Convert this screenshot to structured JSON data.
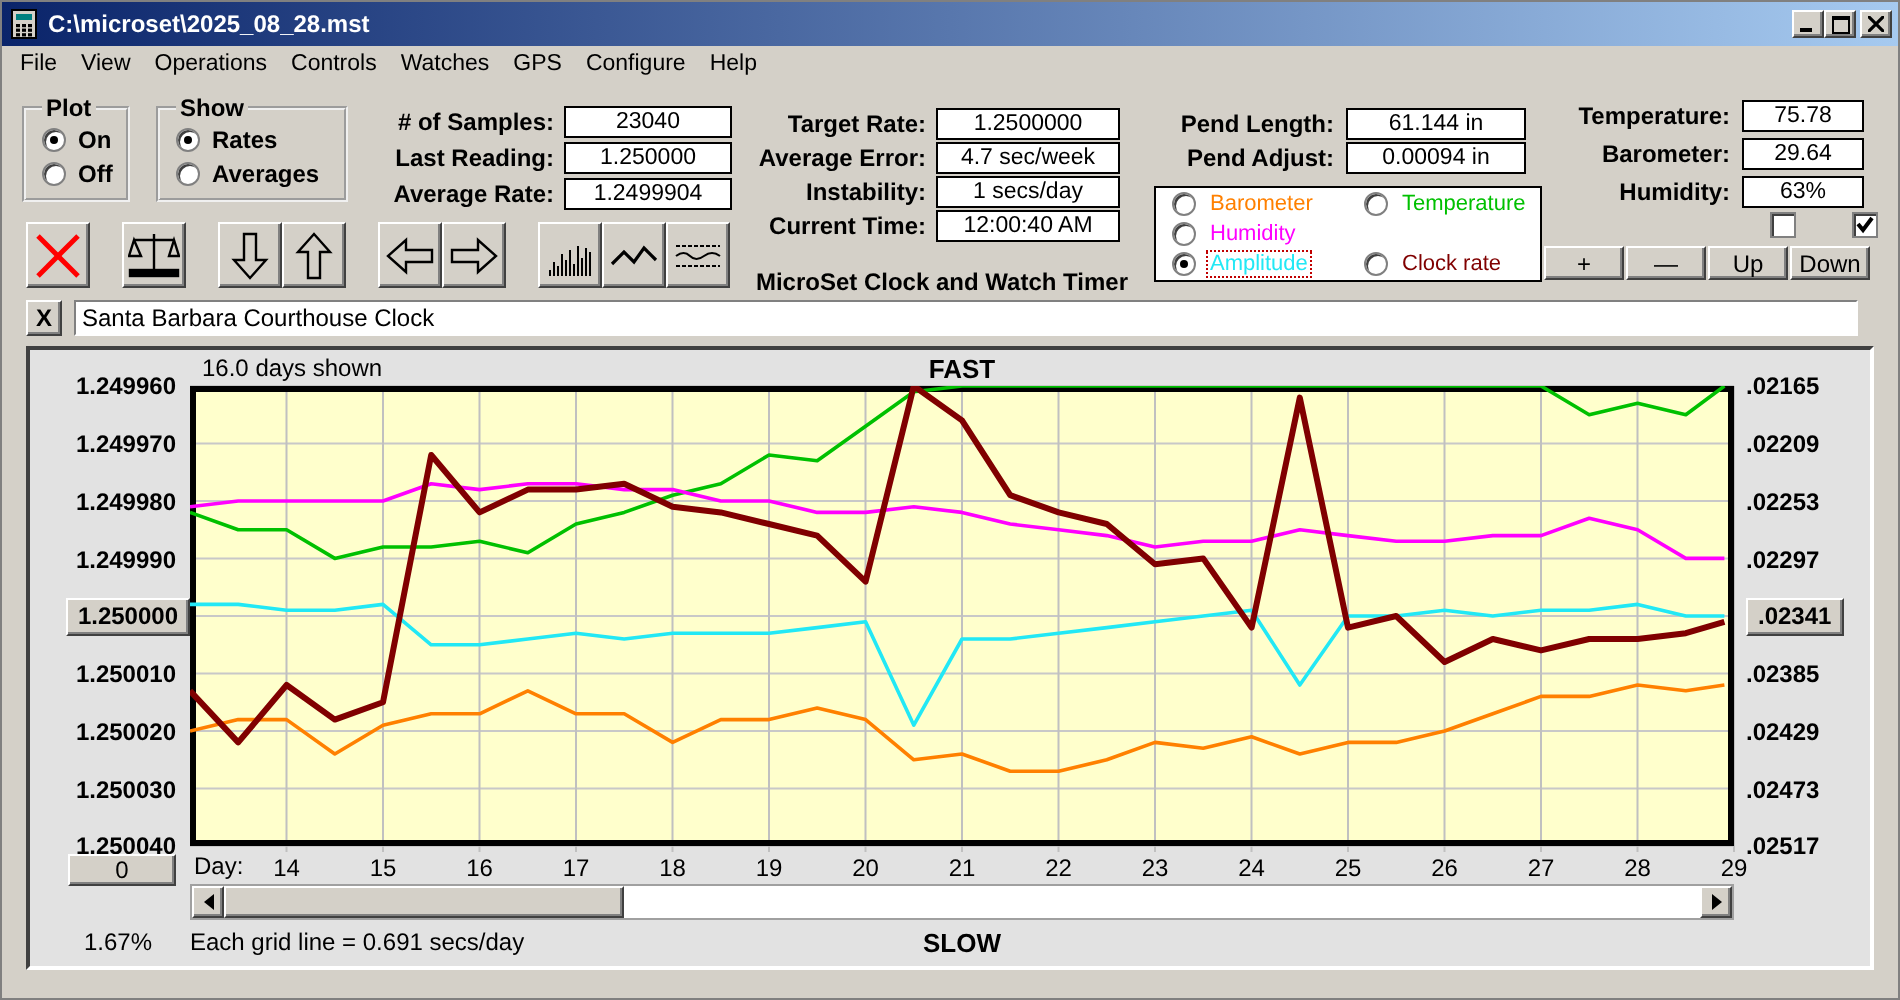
{
  "window": {
    "title": "C:\\microset\\2025_08_28.mst"
  },
  "menu": [
    "File",
    "View",
    "Operations",
    "Controls",
    "Watches",
    "GPS",
    "Configure",
    "Help"
  ],
  "plot_group": {
    "title": "Plot",
    "options": [
      {
        "label": "On",
        "selected": true
      },
      {
        "label": "Off",
        "selected": false
      }
    ]
  },
  "show_group": {
    "title": "Show",
    "options": [
      {
        "label": "Rates",
        "selected": true
      },
      {
        "label": "Averages",
        "selected": false
      }
    ]
  },
  "sample_fields": [
    {
      "label": "# of Samples:",
      "value": "23040"
    },
    {
      "label": "Last Reading:",
      "value": "1.250000"
    },
    {
      "label": "Average Rate:",
      "value": "1.2499904"
    }
  ],
  "rate_fields": [
    {
      "label": "Target Rate:",
      "value": "1.2500000"
    },
    {
      "label": "Average Error:",
      "value": "4.7 sec/week"
    },
    {
      "label": "Instability:",
      "value": "1 secs/day"
    },
    {
      "label": "Current Time:",
      "value": "12:00:40 AM"
    }
  ],
  "app_title": "MicroSet Clock and Watch Timer",
  "pend_fields": [
    {
      "label": "Pend Length:",
      "value": "61.144 in"
    },
    {
      "label": "Pend Adjust:",
      "value": "0.00094 in"
    }
  ],
  "env_fields": [
    {
      "label": "Temperature:",
      "value": "75.78"
    },
    {
      "label": "Barometer:",
      "value": "29.64"
    },
    {
      "label": "Humidity:",
      "value": "63%"
    }
  ],
  "sensor_select": [
    {
      "selected": false
    },
    {
      "selected": false
    },
    {
      "selected": false
    },
    {
      "selected": true
    },
    {
      "selected": false
    }
  ],
  "checkboxes": [
    {
      "checked": false
    },
    {
      "checked": true
    }
  ],
  "adjust_buttons": [
    "+",
    "—",
    "Up",
    "Down"
  ],
  "name_bar": {
    "close": "X",
    "value": "Santa Barbara Courthouse Clock"
  },
  "chart": {
    "days_shown": "16.0 days shown",
    "top_label": "FAST",
    "bottom_label": "SLOW",
    "offset_button": "0",
    "zoom_value": "1.67%",
    "grid_note": "Each grid line = 0.691 secs/day",
    "day_label": "Day:",
    "right_ticks": [
      ".02165",
      ".02209",
      ".02253",
      ".02297",
      ".02341",
      ".02385",
      ".02429",
      ".02473",
      ".02517"
    ],
    "chart_data": {
      "type": "line",
      "xlim": [
        13,
        29
      ],
      "ylim": [
        1.25004,
        1.24996
      ],
      "grid": true,
      "xticks": [
        14,
        15,
        16,
        17,
        18,
        19,
        20,
        21,
        22,
        23,
        24,
        25,
        26,
        27,
        28,
        29
      ],
      "yticks": [
        {
          "value": 1.24996,
          "label": "1.249960"
        },
        {
          "value": 1.24997,
          "label": "1.249970"
        },
        {
          "value": 1.24998,
          "label": "1.249980"
        },
        {
          "value": 1.24999,
          "label": "1.249990"
        },
        {
          "value": 1.25,
          "label": "1.250000"
        },
        {
          "value": 1.25001,
          "label": "1.250010"
        },
        {
          "value": 1.25002,
          "label": "1.250020"
        },
        {
          "value": 1.25003,
          "label": "1.250030"
        },
        {
          "value": 1.25004,
          "label": "1.250040"
        }
      ],
      "x": [
        13,
        13.5,
        14,
        14.5,
        15,
        15.5,
        16,
        16.5,
        17,
        17.5,
        18,
        18.5,
        19,
        19.5,
        20,
        20.5,
        21,
        21.5,
        22,
        22.5,
        23,
        23.5,
        24,
        24.5,
        25,
        25.5,
        26,
        26.5,
        27,
        27.5,
        28,
        28.5,
        28.9
      ],
      "series": [
        {
          "name": "Barometer",
          "color": "#ff8000",
          "values": [
            1.25002,
            1.250018,
            1.250018,
            1.250024,
            1.250019,
            1.250017,
            1.250017,
            1.250013,
            1.250017,
            1.250017,
            1.250022,
            1.250018,
            1.250018,
            1.250016,
            1.250018,
            1.250025,
            1.250024,
            1.250027,
            1.250027,
            1.250025,
            1.250022,
            1.250023,
            1.250021,
            1.250024,
            1.250022,
            1.250022,
            1.25002,
            1.250017,
            1.250014,
            1.250014,
            1.250012,
            1.250013,
            1.250012
          ]
        },
        {
          "name": "Temperature",
          "color": "#00c000",
          "values": [
            1.249982,
            1.249985,
            1.249985,
            1.24999,
            1.249988,
            1.249988,
            1.249987,
            1.249989,
            1.249984,
            1.249982,
            1.249979,
            1.249977,
            1.249972,
            1.249973,
            1.249967,
            1.249961,
            1.24996,
            1.24996,
            1.24996,
            1.24996,
            1.24996,
            1.24996,
            1.24996,
            1.24996,
            1.24996,
            1.24996,
            1.24996,
            1.24996,
            1.24996,
            1.249965,
            1.249963,
            1.249965,
            1.24996
          ]
        },
        {
          "name": "Humidity",
          "color": "#ff00ff",
          "values": [
            1.249981,
            1.24998,
            1.24998,
            1.24998,
            1.24998,
            1.249977,
            1.249978,
            1.249977,
            1.249977,
            1.249978,
            1.249978,
            1.24998,
            1.24998,
            1.249982,
            1.249982,
            1.249981,
            1.249982,
            1.249984,
            1.249985,
            1.249986,
            1.249988,
            1.249987,
            1.249987,
            1.249985,
            1.249986,
            1.249987,
            1.249987,
            1.249986,
            1.249986,
            1.249983,
            1.249985,
            1.24999,
            1.24999
          ]
        },
        {
          "name": "Amplitude",
          "color": "#22e8f5",
          "values": [
            1.249998,
            1.249998,
            1.249999,
            1.249999,
            1.249998,
            1.250005,
            1.250005,
            1.250004,
            1.250003,
            1.250004,
            1.250003,
            1.250003,
            1.250003,
            1.250002,
            1.250001,
            1.250019,
            1.250004,
            1.250004,
            1.250003,
            1.250002,
            1.250001,
            1.25,
            1.249999,
            1.250012,
            1.25,
            1.25,
            1.249999,
            1.25,
            1.249999,
            1.249999,
            1.249998,
            1.25,
            1.25
          ]
        },
        {
          "name": "Clock rate",
          "color": "#800000",
          "values": [
            1.250013,
            1.250022,
            1.250012,
            1.250018,
            1.250015,
            1.249972,
            1.249982,
            1.249978,
            1.249978,
            1.249977,
            1.249981,
            1.249982,
            1.249984,
            1.249986,
            1.249994,
            1.24996,
            1.249966,
            1.249979,
            1.249982,
            1.249984,
            1.249991,
            1.24999,
            1.250002,
            1.249962,
            1.250002,
            1.25,
            1.250008,
            1.250004,
            1.250006,
            1.250004,
            1.250004,
            1.250003,
            1.250001
          ]
        }
      ]
    }
  }
}
